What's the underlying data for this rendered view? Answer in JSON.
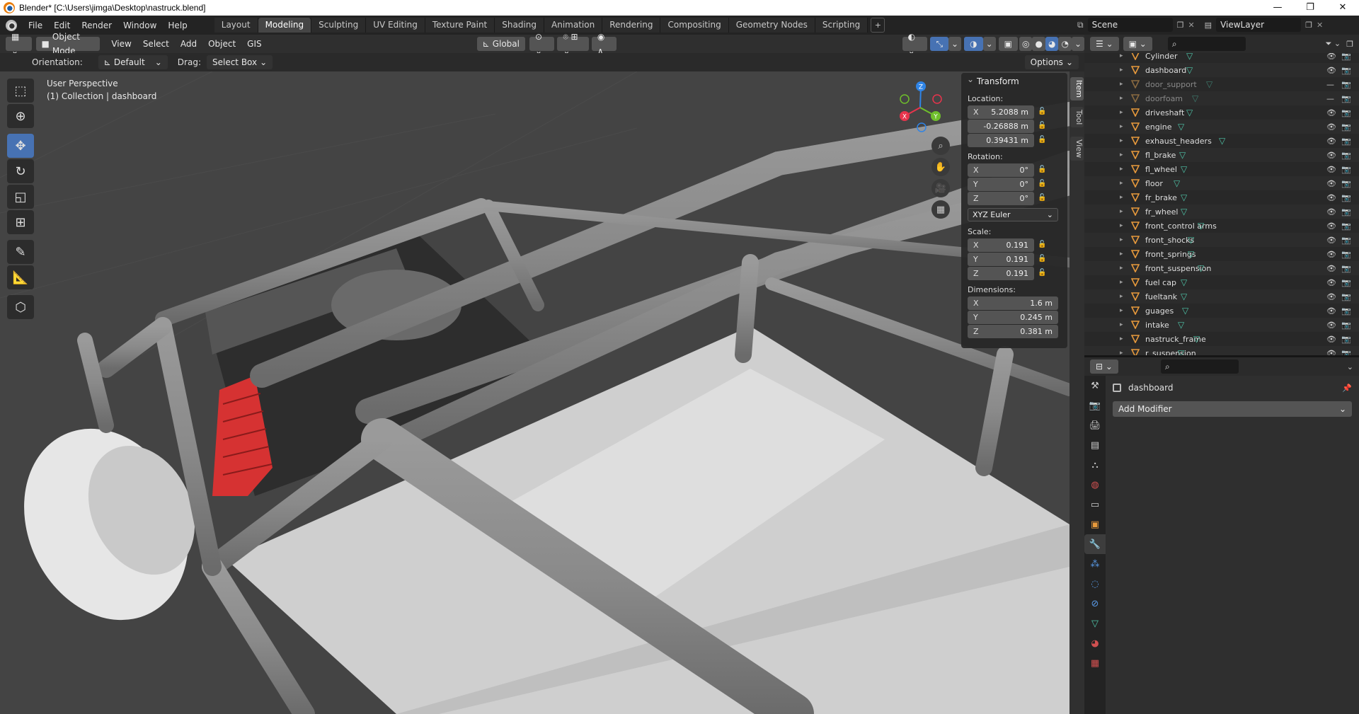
{
  "window": {
    "title": "Blender* [C:\\Users\\jimga\\Desktop\\nastruck.blend]",
    "minimize": "—",
    "maximize": "❐",
    "close": "✕"
  },
  "menu": [
    "File",
    "Edit",
    "Render",
    "Window",
    "Help"
  ],
  "workspaces": [
    "Layout",
    "Modeling",
    "Sculpting",
    "UV Editing",
    "Texture Paint",
    "Shading",
    "Animation",
    "Rendering",
    "Compositing",
    "Geometry Nodes",
    "Scripting"
  ],
  "active_workspace": "Modeling",
  "add_workspace": "+",
  "scene": {
    "name": "Scene",
    "view_layer": "ViewLayer"
  },
  "viewport_header": {
    "mode": "Object Mode",
    "menus": [
      "View",
      "Select",
      "Add",
      "Object",
      "GIS"
    ],
    "transform_orientation": "Global"
  },
  "tool_settings": {
    "orientation_label": "Orientation:",
    "orientation_value": "Default",
    "drag_label": "Drag:",
    "drag_value": "Select Box",
    "options": "Options"
  },
  "viewport_info": {
    "line1": "User Perspective",
    "line2": "(1) Collection | dashboard"
  },
  "side_tabs": [
    "Item",
    "Tool",
    "View"
  ],
  "transform_panel": {
    "title": "Transform",
    "location_label": "Location:",
    "location": [
      {
        "axis": "X",
        "value": "5.2088 m"
      },
      {
        "axis": "",
        "value": "-0.26888 m"
      },
      {
        "axis": "",
        "value": "0.39431 m"
      }
    ],
    "rotation_label": "Rotation:",
    "rotation": [
      {
        "axis": "X",
        "value": "0°"
      },
      {
        "axis": "Y",
        "value": "0°"
      },
      {
        "axis": "Z",
        "value": "0°"
      }
    ],
    "rotation_mode": "XYZ Euler",
    "scale_label": "Scale:",
    "scale": [
      {
        "axis": "X",
        "value": "0.191"
      },
      {
        "axis": "Y",
        "value": "0.191"
      },
      {
        "axis": "Z",
        "value": "0.191"
      }
    ],
    "dimensions_label": "Dimensions:",
    "dimensions": [
      {
        "axis": "X",
        "value": "1.6 m"
      },
      {
        "axis": "Y",
        "value": "0.245 m"
      },
      {
        "axis": "Z",
        "value": "0.381 m"
      }
    ]
  },
  "gizmo_axes": {
    "x": "X",
    "y": "Y",
    "z": "Z"
  },
  "outliner": {
    "items": [
      {
        "name": "Cylinder",
        "dim": false
      },
      {
        "name": "dashboard",
        "dim": false
      },
      {
        "name": "door_support",
        "dim": true
      },
      {
        "name": "doorfoam",
        "dim": true
      },
      {
        "name": "driveshaft",
        "dim": false
      },
      {
        "name": "engine",
        "dim": false
      },
      {
        "name": "exhaust_headers",
        "dim": false
      },
      {
        "name": "fl_brake",
        "dim": false
      },
      {
        "name": "fl_wheel",
        "dim": false
      },
      {
        "name": "floor",
        "dim": false
      },
      {
        "name": "fr_brake",
        "dim": false
      },
      {
        "name": "fr_wheel",
        "dim": false
      },
      {
        "name": "front_control arms",
        "dim": false
      },
      {
        "name": "front_shocks",
        "dim": false
      },
      {
        "name": "front_springs",
        "dim": false
      },
      {
        "name": "front_suspension",
        "dim": false
      },
      {
        "name": "fuel cap",
        "dim": false
      },
      {
        "name": "fueltank",
        "dim": false
      },
      {
        "name": "guages",
        "dim": false
      },
      {
        "name": "intake",
        "dim": false
      },
      {
        "name": "nastruck_frame",
        "dim": false
      },
      {
        "name": "r_suspension",
        "dim": false
      }
    ]
  },
  "properties": {
    "object_name": "dashboard",
    "add_modifier": "Add Modifier"
  },
  "colors": {
    "accent": "#4772b3",
    "mesh_icon": "#4fc4a8",
    "object_icon": "#e89a3c",
    "axis_x": "#e8344c",
    "axis_y": "#6fbf2b",
    "axis_z": "#2f84e6"
  }
}
